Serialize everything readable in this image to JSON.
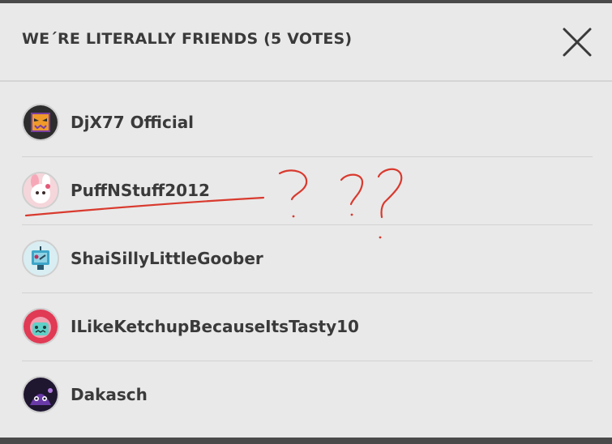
{
  "modal": {
    "title": "WE´RE LITERALLY FRIENDS (5 VOTES)",
    "close_icon": "close-icon"
  },
  "voters": [
    {
      "name": "DjX77 Official",
      "avatar": "purple-demon-face-avatar",
      "avatar_color": "#2d2d2d"
    },
    {
      "name": "PuffNStuff2012",
      "avatar": "pink-bunny-avatar",
      "avatar_color": "#f5d6da"
    },
    {
      "name": "ShaiSillyLittleGoober",
      "avatar": "blue-robot-avatar",
      "avatar_color": "#d8eef3"
    },
    {
      "name": "ILikeKetchupBecauseItsTasty10",
      "avatar": "teal-face-red-hood-avatar",
      "avatar_color": "#e03a55"
    },
    {
      "name": "Dakasch",
      "avatar": "purple-creature-avatar",
      "avatar_color": "#1f1630"
    }
  ],
  "annotation": {
    "color": "#d93a2e"
  }
}
